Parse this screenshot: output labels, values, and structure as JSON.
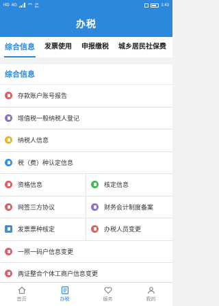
{
  "status": {
    "carrier": "HD",
    "net": "4G",
    "speed_top": "68",
    "speed_unit": "B/s",
    "time": "1:43"
  },
  "header": {
    "title": "办税"
  },
  "tabs": [
    "综合信息",
    "发票使用",
    "申报缴税",
    "城乡居民社保费"
  ],
  "section": {
    "title": "综合信息"
  },
  "rows": [
    [
      {
        "label": "存款账户账号报告",
        "icon": "document-icon",
        "color": "#e35d5d"
      }
    ],
    [
      {
        "label": "增值税一般纳税人登记",
        "icon": "register-icon",
        "color": "#8e6fd8"
      }
    ],
    [
      {
        "label": "纳税人信息",
        "icon": "key-icon",
        "color": "#f2b418"
      }
    ],
    [
      {
        "label": "税（费）种认定信息",
        "icon": "shield-check-icon",
        "color": "#3f8fe0"
      }
    ],
    [
      {
        "label": "资格信息",
        "icon": "qualification-icon",
        "color": "#e35d5d"
      },
      {
        "label": "核定信息",
        "icon": "approval-icon",
        "color": "#3fb950"
      }
    ],
    [
      {
        "label": "网签三方协议",
        "icon": "contract-icon",
        "color": "#e35d5d"
      },
      {
        "label": "财务会计制度备案",
        "icon": "finance-icon",
        "color": "#8e6fd8"
      }
    ],
    [
      {
        "label": "发票票种核定",
        "icon": "invoice-card-icon",
        "color": "#3f8fe0",
        "square": true
      },
      {
        "label": "办税人员变更",
        "icon": "staff-change-icon",
        "color": "#e35d5d"
      }
    ],
    [
      {
        "label": "一照一码户信息变更",
        "icon": "license-icon",
        "color": "#e35d5d"
      }
    ],
    [
      {
        "label": "两证整合个体工商户信息变更",
        "icon": "business-icon",
        "color": "#e35d5d"
      }
    ]
  ],
  "nav": [
    {
      "label": "首页",
      "icon": "home-icon"
    },
    {
      "label": "办税",
      "icon": "tax-list-icon"
    },
    {
      "label": "服务",
      "icon": "heart-icon"
    },
    {
      "label": "我的",
      "icon": "user-icon"
    }
  ],
  "colors": {
    "brand": "#2c88dc"
  }
}
